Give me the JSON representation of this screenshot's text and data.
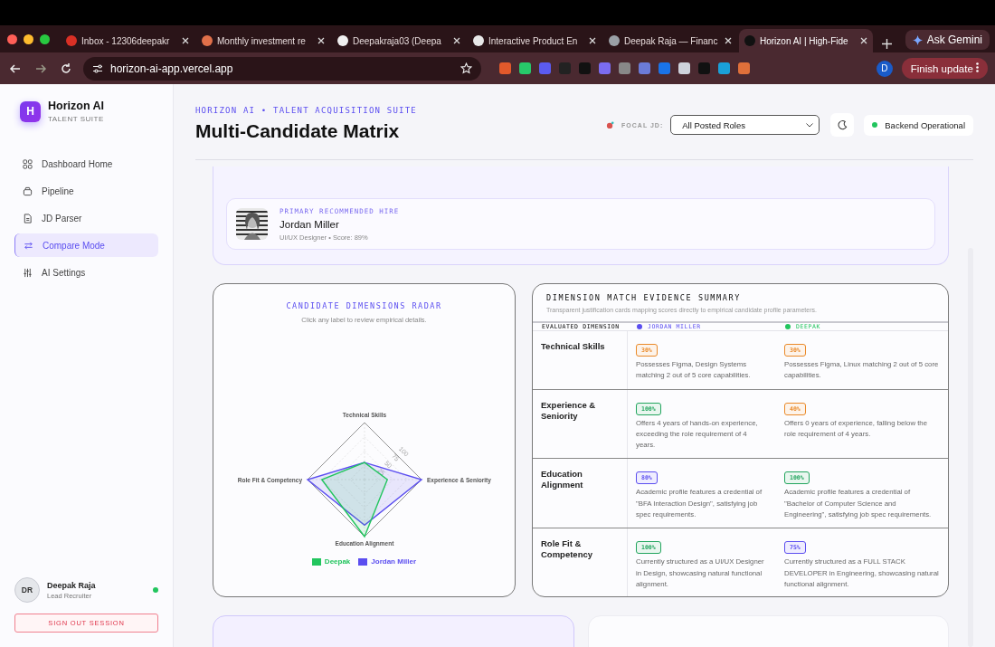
{
  "browser": {
    "tabs": [
      {
        "title": "Inbox - 12306deepakr",
        "selected": false
      },
      {
        "title": "Monthly investment re",
        "selected": false
      },
      {
        "title": "Deepakraja03 (Deepa",
        "selected": false
      },
      {
        "title": "Interactive Product En",
        "selected": false
      },
      {
        "title": "Deepak Raja — Financ",
        "selected": false
      },
      {
        "title": "Horizon AI | High-Fide",
        "selected": true
      }
    ],
    "ask_gemini": "Ask Gemini",
    "address": "horizon-ai-app.vercel.app",
    "profile_initial": "D",
    "finish_update": "Finish update"
  },
  "sidebar": {
    "brand": {
      "initial": "H",
      "name": "Horizon AI",
      "tagline": "TALENT SUITE"
    },
    "items": [
      {
        "label": "Dashboard Home",
        "selected": false
      },
      {
        "label": "Pipeline",
        "selected": false
      },
      {
        "label": "JD Parser",
        "selected": false
      },
      {
        "label": "Compare Mode",
        "selected": true
      },
      {
        "label": "AI Settings",
        "selected": false
      }
    ],
    "user": {
      "initials": "DR",
      "name": "Deepak Raja",
      "role": "Lead Recruiter",
      "online": true
    },
    "sign_out": "SIGN OUT SESSION"
  },
  "header": {
    "eyebrow": "HORIZON AI • TALENT ACQUISITION SUITE",
    "title": "Multi-Candidate Matrix",
    "focal_label": "FOCAL JD:",
    "focal_value": "All Posted Roles",
    "status": "Backend Operational"
  },
  "recommended": {
    "label": "PRIMARY RECOMMENDED HIRE",
    "name": "Jordan Miller",
    "subtitle": "UI/UX Designer • Score: 89%"
  },
  "radar": {
    "title": "CANDIDATE DIMENSIONS RADAR",
    "hint": "Click any label to review empirical details.",
    "axes": [
      "Technical Skills",
      "Experience & Seniority",
      "Education Alignment",
      "Role Fit & Competency"
    ],
    "ticks": [
      "25",
      "50",
      "75",
      "100"
    ],
    "legend": [
      {
        "name": "Deepak",
        "color": "#22c55e"
      },
      {
        "name": "Jordan Miller",
        "color": "#5b4ef0"
      }
    ]
  },
  "evidence": {
    "title": "DIMENSION MATCH EVIDENCE SUMMARY",
    "subtitle": "Transparent justification cards mapping scores directly to empirical candidate profile parameters.",
    "dimension_heading": "EVALUATED DIMENSION",
    "candidates": [
      {
        "name": "JORDAN MILLER",
        "color": "#5b4ef0"
      },
      {
        "name": "DEEPAK",
        "color": "#22c55e"
      }
    ],
    "rows": [
      {
        "dimension": "Technical Skills",
        "cells": [
          {
            "score": "30%",
            "color": "#ea8a2a",
            "text": "Possesses Figma, Design Systems matching 2 out of 5 core capabilities."
          },
          {
            "score": "30%",
            "color": "#ea8a2a",
            "text": "Possesses Figma, Linux matching 2 out of 5 core capabilities."
          }
        ]
      },
      {
        "dimension": "Experience & Seniority",
        "cells": [
          {
            "score": "100%",
            "color": "#22a55e",
            "text": "Offers 4 years of hands-on experience, exceeding the role requirement of 4 years."
          },
          {
            "score": "40%",
            "color": "#ea8a2a",
            "text": "Offers 0 years of experience, falling below the role requirement of 4 years."
          }
        ]
      },
      {
        "dimension": "Education Alignment",
        "cells": [
          {
            "score": "80%",
            "color": "#5b4ef0",
            "text": "Academic profile features a credential of \"BFA Interaction Design\", satisfying job spec requirements."
          },
          {
            "score": "100%",
            "color": "#22a55e",
            "text": "Academic profile features a credential of \"Bachelor of Computer Science and Engineering\", satisfying job spec requirements."
          }
        ]
      },
      {
        "dimension": "Role Fit & Competency",
        "cells": [
          {
            "score": "100%",
            "color": "#22a55e",
            "text": "Currently structured as a UI/UX Designer in Design, showcasing natural functional alignment."
          },
          {
            "score": "75%",
            "color": "#5b4ef0",
            "text": "Currently structured as a FULL STACK DEVELOPER in Engineering, showcasing natural functional alignment."
          }
        ]
      }
    ]
  }
}
